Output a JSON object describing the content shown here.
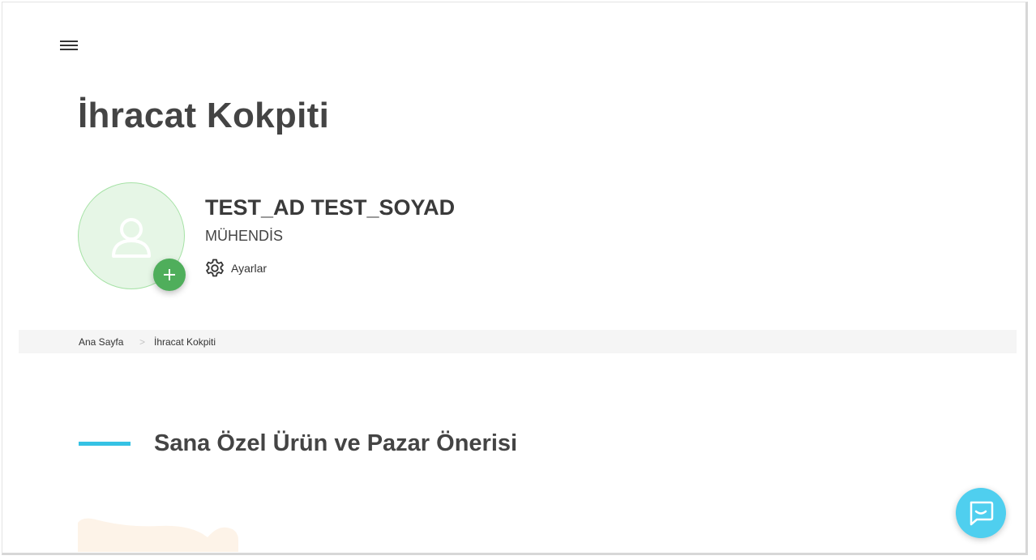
{
  "header": {
    "menu_icon": "hamburger-menu-icon"
  },
  "page": {
    "title": "İhracat Kokpiti"
  },
  "profile": {
    "name": "TEST_AD TEST_SOYAD",
    "role": "MÜHENDİS",
    "settings_label": "Ayarlar",
    "avatar_icon": "user-placeholder-icon",
    "add_photo_icon": "plus-icon",
    "settings_icon": "gear-icon"
  },
  "breadcrumb": {
    "items": [
      "Ana Sayfa",
      "İhracat Kokpiti"
    ],
    "separator": ">"
  },
  "section": {
    "title": "Sana Özel Ürün ve Pazar Önerisi"
  },
  "chat": {
    "icon": "chat-message-icon"
  },
  "colors": {
    "accent_cyan": "#35c2e4",
    "chat_button": "#4fcfef",
    "avatar_bg": "#e6f6e6",
    "add_button": "#4fae5b",
    "title_text": "#444444",
    "breadcrumb_bg": "#f5f5f5"
  }
}
